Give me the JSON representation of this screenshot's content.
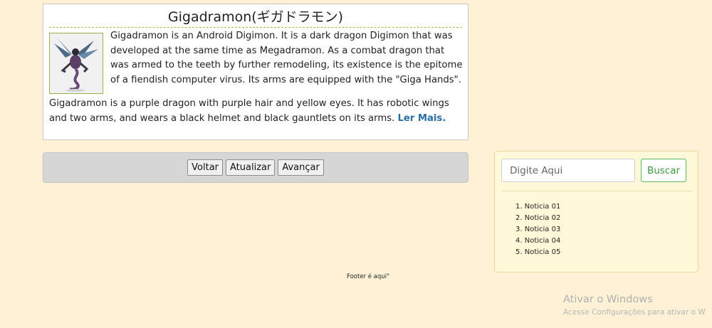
{
  "article": {
    "title": "Gigadramon(ギガドラモン)",
    "image_alt": "Gigadramon",
    "paragraph1": "Gigadramon is an Android Digimon. It is a dark dragon Digimon that was developed at the same time as Megadramon. As a combat dragon that was armed to the teeth by further remodeling, its existence is the epitome of a fiendish computer virus. Its arms are equipped with the \"Giga Hands\".",
    "paragraph2": "Gigadramon is a purple dragon with purple hair and yellow eyes. It has robotic wings and two arms, and wears a black helmet and black gauntlets on its arms.",
    "read_more": "Ler Mais."
  },
  "navigation": {
    "back_label": "Voltar",
    "refresh_label": "Atualizar",
    "next_label": "Avançar"
  },
  "sidebar": {
    "search_placeholder": "Digite Aqui",
    "search_button": "Buscar",
    "news": [
      "Noticia 01",
      "Noticia 02",
      "Noticia 03",
      "Noticia 04",
      "Noticia 05"
    ]
  },
  "footer": {
    "text": "Footer é aqui\""
  },
  "os_watermark": {
    "title": "Ativar o Windows",
    "subtitle": "Acesse Configurações para ativar o W"
  }
}
